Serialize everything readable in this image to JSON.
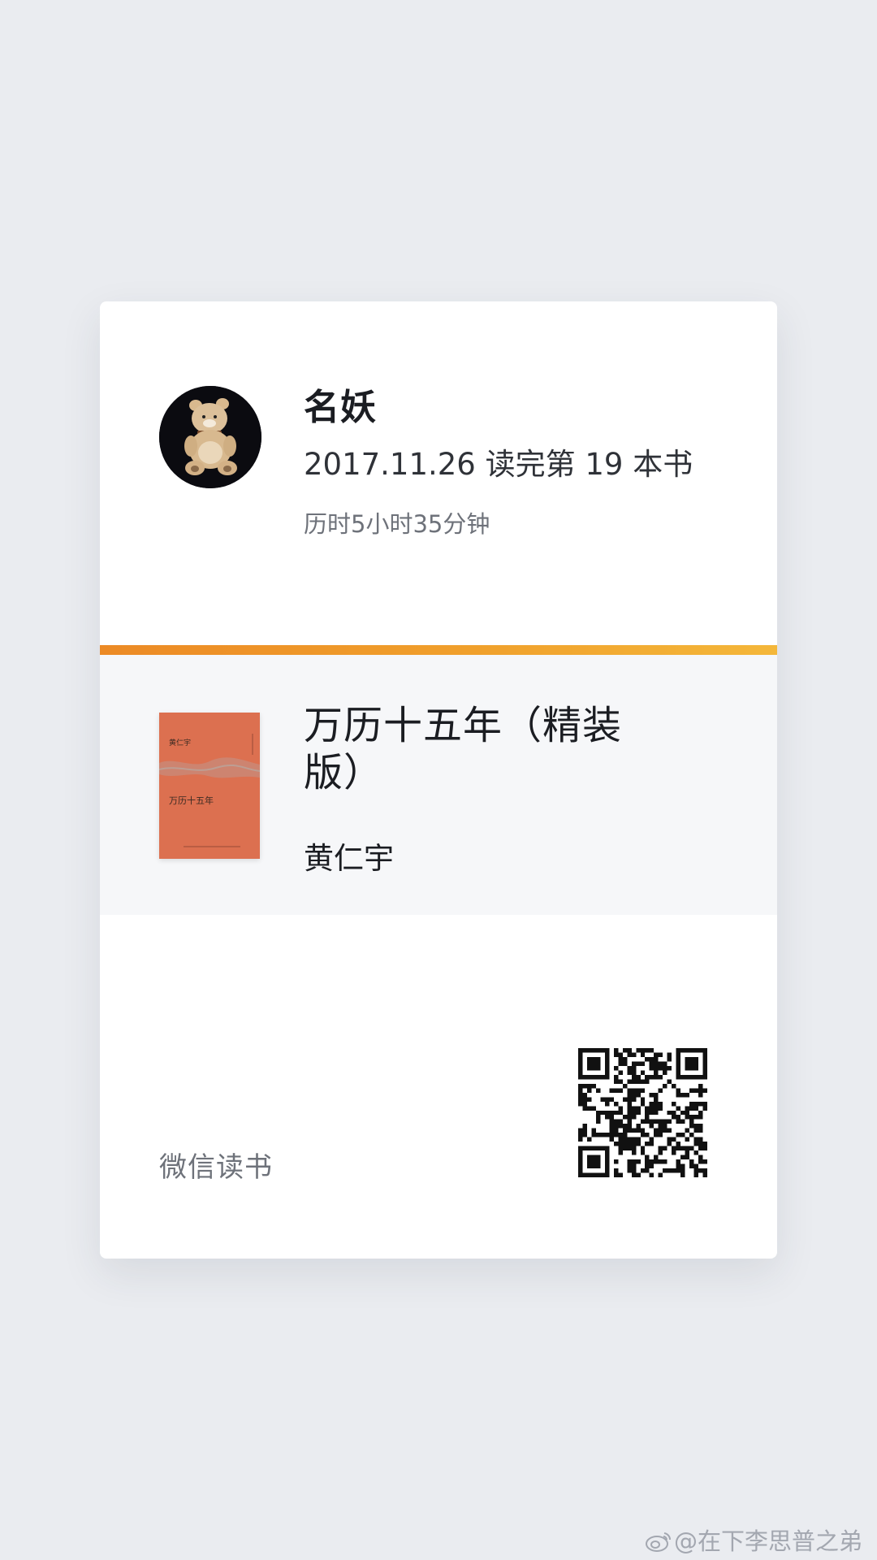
{
  "user": {
    "avatar_icon": "bear-avatar-icon",
    "name": "名妖",
    "progress_text": "2017.11.26 读完第 19 本书",
    "duration_text": "历时5小时35分钟"
  },
  "book": {
    "title": "万历十五年（精装版）",
    "author": "黄仁宇",
    "cover_title": "万历十五年",
    "cover_author": "黄仁宇",
    "cover_color": "#dc7050"
  },
  "footer": {
    "brand": "微信读书",
    "qr_icon": "qr-code-icon"
  },
  "watermark": {
    "text": "@在下李思普之弟",
    "icon": "weibo-icon"
  },
  "colors": {
    "accent_start": "#ec8a25",
    "accent_end": "#f4b73a",
    "page_background": "#eaecf0"
  }
}
